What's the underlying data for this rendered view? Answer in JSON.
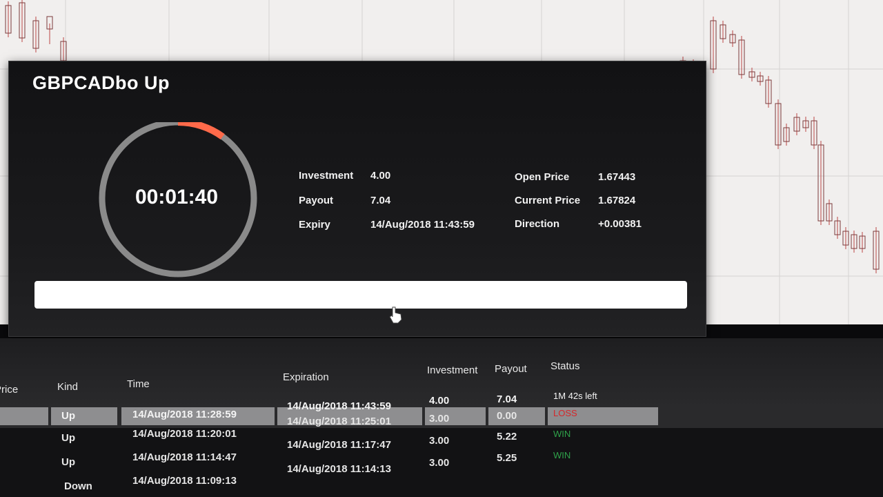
{
  "popup": {
    "title": "GBPCADbo Up",
    "timer": "00:01:40",
    "timer_progress_fraction": 0.1,
    "investment_label": "Investment",
    "investment_value": "4.00",
    "payout_label": "Payout",
    "payout_value": "7.04",
    "expiry_label": "Expiry",
    "expiry_value": "14/Aug/2018 11:43:59",
    "open_price_label": "Open Price",
    "open_price_value": "1.67443",
    "current_price_label": "Current Price",
    "current_price_value": "1.67824",
    "direction_label": "Direction",
    "direction_value": "+0.00381"
  },
  "table": {
    "headers": {
      "price": "Price",
      "kind": "Kind",
      "time": "Time",
      "expiration": "Expiration",
      "investment": "Investment",
      "payout": "Payout",
      "status": "Status"
    },
    "rows": [
      {
        "kind": "Up",
        "time": "14/Aug/2018 11:28:59",
        "expiration": "14/Aug/2018 11:43:59",
        "investment": "4.00",
        "payout": "7.04",
        "status": "1M 42s left",
        "status_type": "open"
      },
      {
        "kind": "Up",
        "time": "14/Aug/2018 11:20:01",
        "expiration": "14/Aug/2018 11:25:01",
        "investment": "3.00",
        "payout": "0.00",
        "status": "LOSS",
        "status_type": "loss"
      },
      {
        "kind": "Up",
        "time": "14/Aug/2018 11:14:47",
        "expiration": "14/Aug/2018 11:17:47",
        "investment": "3.00",
        "payout": "5.22",
        "status": "WIN",
        "status_type": "win"
      },
      {
        "kind": "Down",
        "time": "14/Aug/2018 11:09:13",
        "expiration": "14/Aug/2018 11:14:13",
        "investment": "3.00",
        "payout": "5.25",
        "status": "WIN",
        "status_type": "win"
      }
    ]
  },
  "colors": {
    "ring_track": "#8a8a8a",
    "ring_progress": "#ff6a4a",
    "loss": "#d6262a",
    "win": "#2fa24a"
  }
}
